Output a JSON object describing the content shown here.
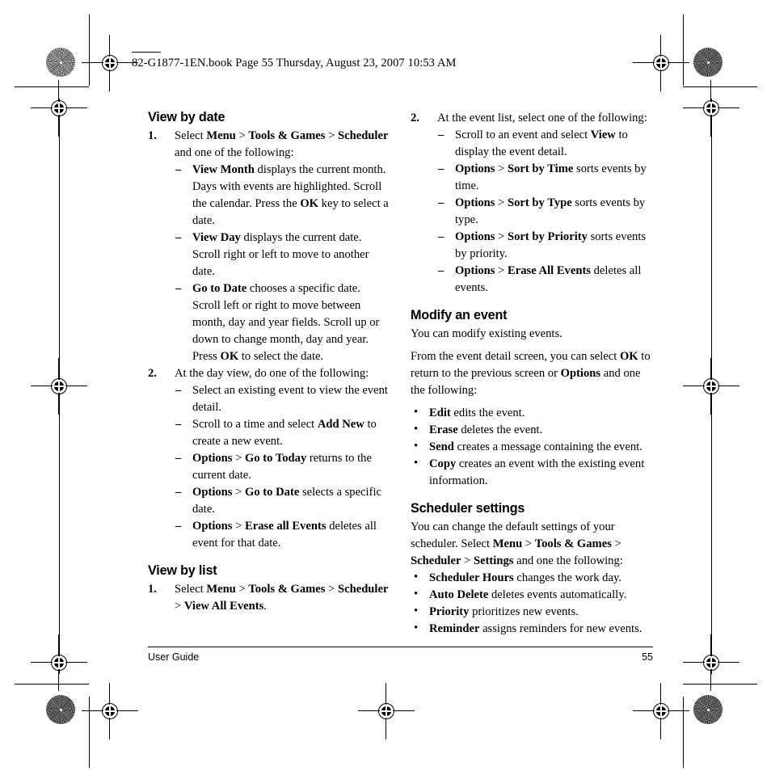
{
  "slug": {
    "text": "82-G1877-1EN.book  Page 55  Thursday, August 23, 2007  10:53 AM"
  },
  "left_column": {
    "heading_1": "View by date",
    "step_1": {
      "number": "1.",
      "text_parts": [
        {
          "t": "Select ",
          "b": false
        },
        {
          "t": "Menu",
          "b": true
        },
        {
          "t": " > ",
          "b": false
        },
        {
          "t": "Tools & Games",
          "b": true
        },
        {
          "t": " > ",
          "b": false
        },
        {
          "t": "Scheduler",
          "b": true
        },
        {
          "t": " and one of the following:",
          "b": false
        }
      ],
      "sub_items": [
        [
          {
            "t": "View Month",
            "b": true
          },
          {
            "t": " displays the current month. Days with events are highlighted. Scroll the calendar. Press the ",
            "b": false
          },
          {
            "t": "OK",
            "b": true
          },
          {
            "t": " key to select a date.",
            "b": false
          }
        ],
        [
          {
            "t": "View Day",
            "b": true
          },
          {
            "t": " displays the current date. Scroll right or left to move to another date.",
            "b": false
          }
        ],
        [
          {
            "t": "Go to Date",
            "b": true
          },
          {
            "t": " chooses a specific date. Scroll left or right to move between month, day and year fields. Scroll up or down to change month, day and year. Press ",
            "b": false
          },
          {
            "t": "OK",
            "b": true
          },
          {
            "t": " to select the date.",
            "b": false
          }
        ]
      ]
    },
    "step_2": {
      "number": "2.",
      "text_parts": [
        {
          "t": "At the day view, do one of the following:",
          "b": false
        }
      ],
      "sub_items": [
        [
          {
            "t": "Select an existing event to view the event detail.",
            "b": false
          }
        ],
        [
          {
            "t": "Scroll to a time and select ",
            "b": false
          },
          {
            "t": "Add New",
            "b": true
          },
          {
            "t": " to create a new event.",
            "b": false
          }
        ],
        [
          {
            "t": "Options",
            "b": true
          },
          {
            "t": " > ",
            "b": false
          },
          {
            "t": "Go to Today",
            "b": true
          },
          {
            "t": " returns to the current date.",
            "b": false
          }
        ],
        [
          {
            "t": "Options",
            "b": true
          },
          {
            "t": " > ",
            "b": false
          },
          {
            "t": "Go to Date",
            "b": true
          },
          {
            "t": " selects a specific date.",
            "b": false
          }
        ],
        [
          {
            "t": "Options",
            "b": true
          },
          {
            "t": " > ",
            "b": false
          },
          {
            "t": "Erase all Events",
            "b": true
          },
          {
            "t": " deletes all event for that date.",
            "b": false
          }
        ]
      ]
    },
    "heading_2": "View by list",
    "step_3": {
      "number": "1.",
      "text_parts": [
        {
          "t": "Select ",
          "b": false
        },
        {
          "t": "Menu",
          "b": true
        },
        {
          "t": " > ",
          "b": false
        },
        {
          "t": "Tools & Games",
          "b": true
        },
        {
          "t": " > ",
          "b": false
        },
        {
          "t": "Scheduler",
          "b": true
        },
        {
          "t": " > ",
          "b": false
        },
        {
          "t": "View All Events",
          "b": true
        },
        {
          "t": ".",
          "b": false
        }
      ]
    }
  },
  "right_column": {
    "step_1": {
      "number": "2.",
      "text_parts": [
        {
          "t": "At the event list, select one of the following:",
          "b": false
        }
      ],
      "sub_items": [
        [
          {
            "t": "Scroll to an event and select ",
            "b": false
          },
          {
            "t": "View",
            "b": true
          },
          {
            "t": " to display the event detail.",
            "b": false
          }
        ],
        [
          {
            "t": "Options",
            "b": true
          },
          {
            "t": " > ",
            "b": false
          },
          {
            "t": "Sort by Time",
            "b": true
          },
          {
            "t": " sorts events by time.",
            "b": false
          }
        ],
        [
          {
            "t": "Options",
            "b": true
          },
          {
            "t": " > ",
            "b": false
          },
          {
            "t": "Sort by Type",
            "b": true
          },
          {
            "t": " sorts events by type.",
            "b": false
          }
        ],
        [
          {
            "t": "Options",
            "b": true
          },
          {
            "t": " > ",
            "b": false
          },
          {
            "t": "Sort by Priority",
            "b": true
          },
          {
            "t": " sorts events by priority.",
            "b": false
          }
        ],
        [
          {
            "t": "Options",
            "b": true
          },
          {
            "t": " > ",
            "b": false
          },
          {
            "t": "Erase All Events",
            "b": true
          },
          {
            "t": " deletes all events.",
            "b": false
          }
        ]
      ]
    },
    "heading_1": "Modify an event",
    "para_1": [
      {
        "t": "You can modify existing events.",
        "b": false
      }
    ],
    "para_2": [
      {
        "t": "From the event detail screen, you can select ",
        "b": false
      },
      {
        "t": "OK",
        "b": true
      },
      {
        "t": " to return to the previous screen or ",
        "b": false
      },
      {
        "t": "Options",
        "b": true
      },
      {
        "t": " and one the following:",
        "b": false
      }
    ],
    "bullets_1": [
      [
        {
          "t": "Edit",
          "b": true
        },
        {
          "t": " edits the event.",
          "b": false
        }
      ],
      [
        {
          "t": "Erase",
          "b": true
        },
        {
          "t": " deletes the event.",
          "b": false
        }
      ],
      [
        {
          "t": "Send",
          "b": true
        },
        {
          "t": " creates a message containing the event.",
          "b": false
        }
      ],
      [
        {
          "t": "Copy",
          "b": true
        },
        {
          "t": " creates an event with the existing event information.",
          "b": false
        }
      ]
    ],
    "heading_2": "Scheduler settings",
    "para_3": [
      {
        "t": "You can change the default settings of your scheduler. Select ",
        "b": false
      },
      {
        "t": "Menu",
        "b": true
      },
      {
        "t": " > ",
        "b": false
      },
      {
        "t": "Tools & Games",
        "b": true
      },
      {
        "t": " > ",
        "b": false
      },
      {
        "t": "Scheduler",
        "b": true
      },
      {
        "t": " > ",
        "b": false
      },
      {
        "t": "Settings",
        "b": true
      },
      {
        "t": " and one the following:",
        "b": false
      }
    ],
    "bullets_2": [
      [
        {
          "t": "Scheduler Hours",
          "b": true
        },
        {
          "t": " changes the work day.",
          "b": false
        }
      ],
      [
        {
          "t": "Auto Delete",
          "b": true
        },
        {
          "t": " deletes events automatically.",
          "b": false
        }
      ],
      [
        {
          "t": "Priority",
          "b": true
        },
        {
          "t": " prioritizes new events.",
          "b": false
        }
      ],
      [
        {
          "t": "Reminder",
          "b": true
        },
        {
          "t": " assigns reminders for new events.",
          "b": false
        }
      ]
    ]
  },
  "footer": {
    "left": "User Guide",
    "page_number": "55"
  },
  "symbols": {
    "dash": "–",
    "bullet": "•"
  }
}
